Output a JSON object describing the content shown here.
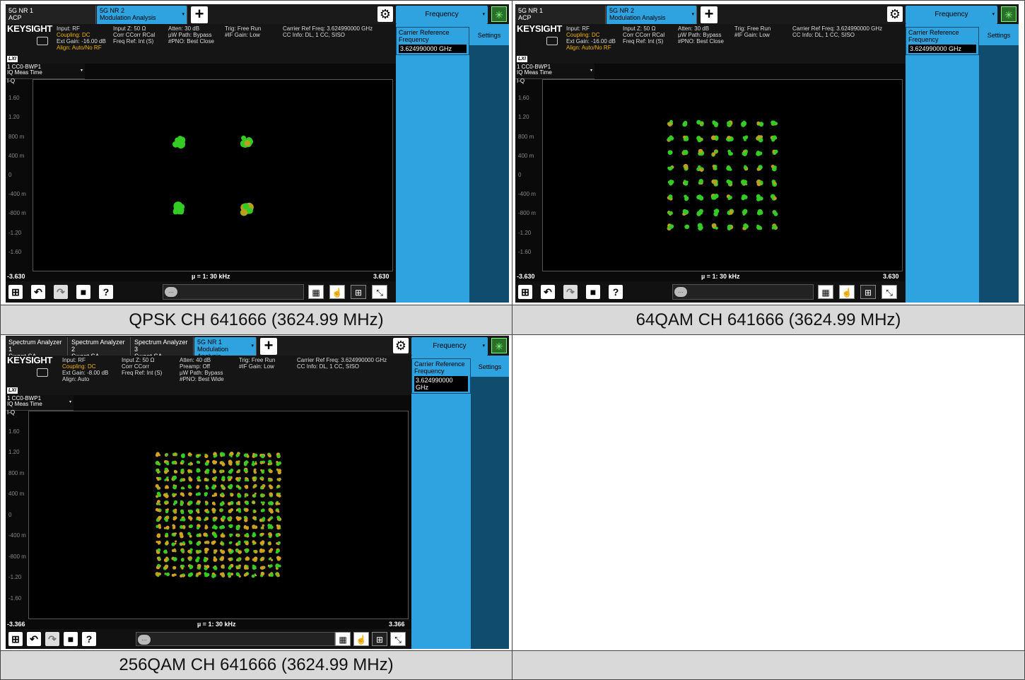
{
  "screens": [
    {
      "tabs": [
        {
          "line1": "5G NR 1",
          "line2": "ACP",
          "active": false
        },
        {
          "line1": "5G NR 2",
          "line2": "Modulation Analysis",
          "active": true
        }
      ],
      "frequency_button": "Frequency",
      "brand": "KEYSIGHT",
      "info_col1": [
        "Input: RF",
        "Coupling: DC",
        "Ext Gain: -16.00 dB",
        "Align: Auto/No RF"
      ],
      "info_col2": [
        "Input Z: 50 Ω",
        "Corr CCorr RCal",
        "Freq Ref: Int (S)"
      ],
      "info_col3": [
        "Atten: 30 dB",
        "µW Path: Bypass",
        "#PNO: Best Close"
      ],
      "info_col4": [
        "Trig: Free Run",
        "#IF Gain: Low"
      ],
      "info_col5": [
        "Carrier Ref Freq: 3.624990000 GHz",
        "CC Info: DL, 1 CC, SISO"
      ],
      "lxi": "LXI",
      "carrier_ref_label": "Carrier Reference Frequency",
      "carrier_ref_value": "3.624990000 GHz",
      "settings_button": "Settings",
      "trace_select": {
        "line1": "1 CC0-BWP1",
        "line2": "IQ Meas Time"
      },
      "plot_label": "I-Q",
      "y_ticks": [
        "1.60",
        "1.20",
        "800 m",
        "400 m",
        "0",
        "-400 m",
        "-800 m",
        "-1.20",
        "-1.60"
      ],
      "x_left": "-3.630",
      "x_center": "µ = 1: 30 kHz",
      "x_right": "3.630",
      "constellation": {
        "type": "scatter",
        "modulation": "QPSK",
        "points_per_side": 2,
        "extent": 0.707,
        "color": "#33cc22"
      }
    },
    {
      "tabs": [
        {
          "line1": "5G NR 1",
          "line2": "ACP",
          "active": false
        },
        {
          "line1": "5G NR 2",
          "line2": "Modulation Analysis",
          "active": true
        }
      ],
      "frequency_button": "Frequency",
      "brand": "KEYSIGHT",
      "info_col1": [
        "Input: RF",
        "Coupling: DC",
        "Ext Gain: -16.00 dB",
        "Align: Auto/No RF"
      ],
      "info_col2": [
        "Input Z: 50 Ω",
        "Corr CCorr RCal",
        "Freq Ref: Int (S)"
      ],
      "info_col3": [
        "Atten: 30 dB",
        "µW Path: Bypass",
        "#PNO: Best Close"
      ],
      "info_col4": [
        "Trig: Free Run",
        "#IF Gain: Low"
      ],
      "info_col5": [
        "Carrier Ref Freq: 3.624990000 GHz",
        "CC Info: DL, 1 CC, SISO"
      ],
      "lxi": "LXI",
      "carrier_ref_label": "Carrier Reference Frequency",
      "carrier_ref_value": "3.624990000 GHz",
      "settings_button": "Settings",
      "trace_select": {
        "line1": "1 CC0-BWP1",
        "line2": "IQ Meas Time"
      },
      "plot_label": "I-Q",
      "y_ticks": [
        "1.60",
        "1.20",
        "800 m",
        "400 m",
        "0",
        "-400 m",
        "-800 m",
        "-1.20",
        "-1.60"
      ],
      "x_left": "-3.630",
      "x_center": "µ = 1: 30 kHz",
      "x_right": "3.630",
      "constellation": {
        "type": "scatter",
        "modulation": "64QAM",
        "points_per_side": 8,
        "extent": 1.08,
        "color": "#33cc22"
      }
    },
    {
      "tabs": [
        {
          "line1": "Spectrum Analyzer 1",
          "line2": "Swept SA",
          "active": false
        },
        {
          "line1": "Spectrum Analyzer 2",
          "line2": "Swept SA",
          "active": false
        },
        {
          "line1": "Spectrum Analyzer 3",
          "line2": "Swept SA",
          "active": false
        },
        {
          "line1": "5G NR 1",
          "line2": "Modulation Analysis",
          "active": true
        }
      ],
      "frequency_button": "Frequency",
      "brand": "KEYSIGHT",
      "info_col1": [
        "Input: RF",
        "Coupling: DC",
        "Ext Gain: -8.00 dB",
        "Align: Auto"
      ],
      "info_col2": [
        "Input Z: 50 Ω",
        "Corr CCorr",
        "Freq Ref: Int (S)"
      ],
      "info_col3": [
        "Atten: 40 dB",
        "Preamp: Off",
        "µW Path: Bypass",
        "#PNO: Best Wide"
      ],
      "info_col4": [
        "Trig: Free Run",
        "#IF Gain: Low"
      ],
      "info_col5": [
        "Carrier Ref Freq: 3.624990000 GHz",
        "CC Info: DL, 1 CC, SISO"
      ],
      "lxi": "LXI",
      "carrier_ref_label": "Carrier Reference Frequency",
      "carrier_ref_value": "3.624990000 GHz",
      "settings_button": "Settings",
      "trace_select": {
        "line1": "1 CC0-BWP1",
        "line2": "IQ Meas Time"
      },
      "plot_label": "I-Q",
      "y_ticks": [
        "1.60",
        "1.20",
        "800 m",
        "400 m",
        "0",
        "-400 m",
        "-800 m",
        "-1.20",
        "-1.60"
      ],
      "x_left": "-3.366",
      "x_center": "µ = 1: 30 kHz",
      "x_right": "3.366",
      "constellation": {
        "type": "scatter",
        "modulation": "256QAM",
        "points_per_side": 16,
        "extent": 1.15,
        "color": "#33cc22"
      }
    }
  ],
  "captions": [
    "QPSK CH 641666 (3624.99 MHz)",
    "64QAM CH 641666 (3624.99 MHz)",
    "256QAM CH 641666 (3624.99 MHz)",
    ""
  ]
}
